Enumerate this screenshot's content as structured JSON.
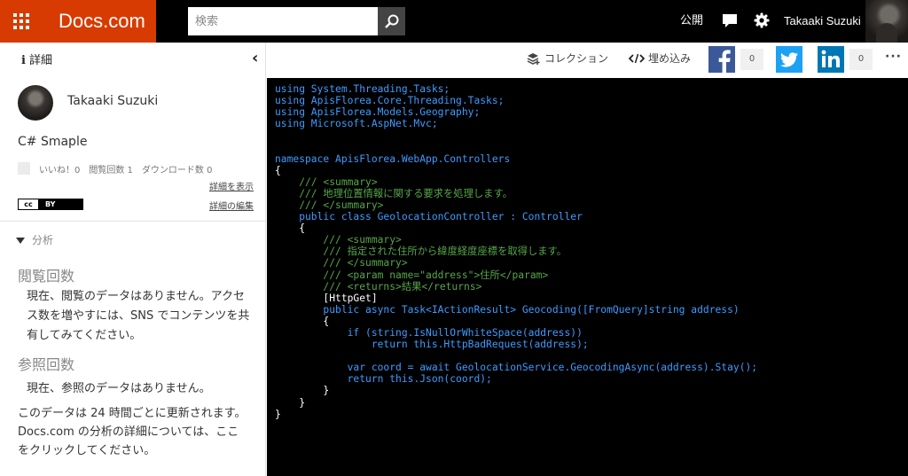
{
  "header": {
    "brand": "Docs.com",
    "search_placeholder": "検索",
    "public_label": "公開",
    "username": "Takaaki Suzuki"
  },
  "sidebar": {
    "details_label": "詳細",
    "collapse_glyph": "‹",
    "author": "Takaaki Suzuki",
    "document_title": "C# Smaple",
    "stats": "いいね！0　閲覧回数 1　ダウンロード数 0",
    "show_details_link": "詳細を表示",
    "edit_details_link": "詳細の編集",
    "license": {
      "left": "cc",
      "right": "BY"
    },
    "analysis_label": "分析",
    "views_heading": "閲覧回数",
    "views_text": "現在、閲覧のデータはありません。アクセス数を増やすには、SNS でコンテンツを共有してみてください。",
    "refs_heading": "参照回数",
    "refs_text": "現在、参照のデータはありません。",
    "footer_text": "このデータは 24 時間ごとに更新されます。Docs.com の分析の詳細については、ここをクリックしてください。"
  },
  "toolbar": {
    "collection_label": "コレクション",
    "embed_label": "埋め込み",
    "facebook_count": "0",
    "linkedin_count": "0",
    "more_label": "···"
  },
  "colors": {
    "brand": "#d83b01",
    "facebook": "#3b5998",
    "twitter": "#1da1f2",
    "linkedin": "#0077b5",
    "code_bg": "#000000"
  },
  "code": {
    "l1": "using System.Threading.Tasks;",
    "l2": "using ApisFlorea.Core.Threading.Tasks;",
    "l3": "using ApisFlorea.Models.Geography;",
    "l4": "using Microsoft.AspNet.Mvc;",
    "l5": "namespace ApisFlorea.WebApp.Controllers",
    "l6": "{",
    "l7": "    /// <summary>",
    "l8": "    /// 地理位置情報に関する要求を処理します。",
    "l9": "    /// </summary>",
    "l10": "    public class GeolocationController : Controller",
    "l11": "    {",
    "l12": "        /// <summary>",
    "l13": "        /// 指定された住所から緯度経度座標を取得します。",
    "l14": "        /// </summary>",
    "l15": "        /// <param name=\"address\">住所</param>",
    "l16": "        /// <returns>結果</returns>",
    "l17": "        [HttpGet]",
    "l18": "        public async Task<IActionResult> Geocoding([FromQuery]string address)",
    "l19": "        {",
    "l20": "            if (string.IsNullOrWhiteSpace(address))",
    "l21": "                return this.HttpBadRequest(address);",
    "l22": "            var coord = await GeolocationService.GeocodingAsync(address).Stay();",
    "l23": "            return this.Json(coord);",
    "l24": "        }",
    "l25": "    }",
    "l26": "}"
  }
}
